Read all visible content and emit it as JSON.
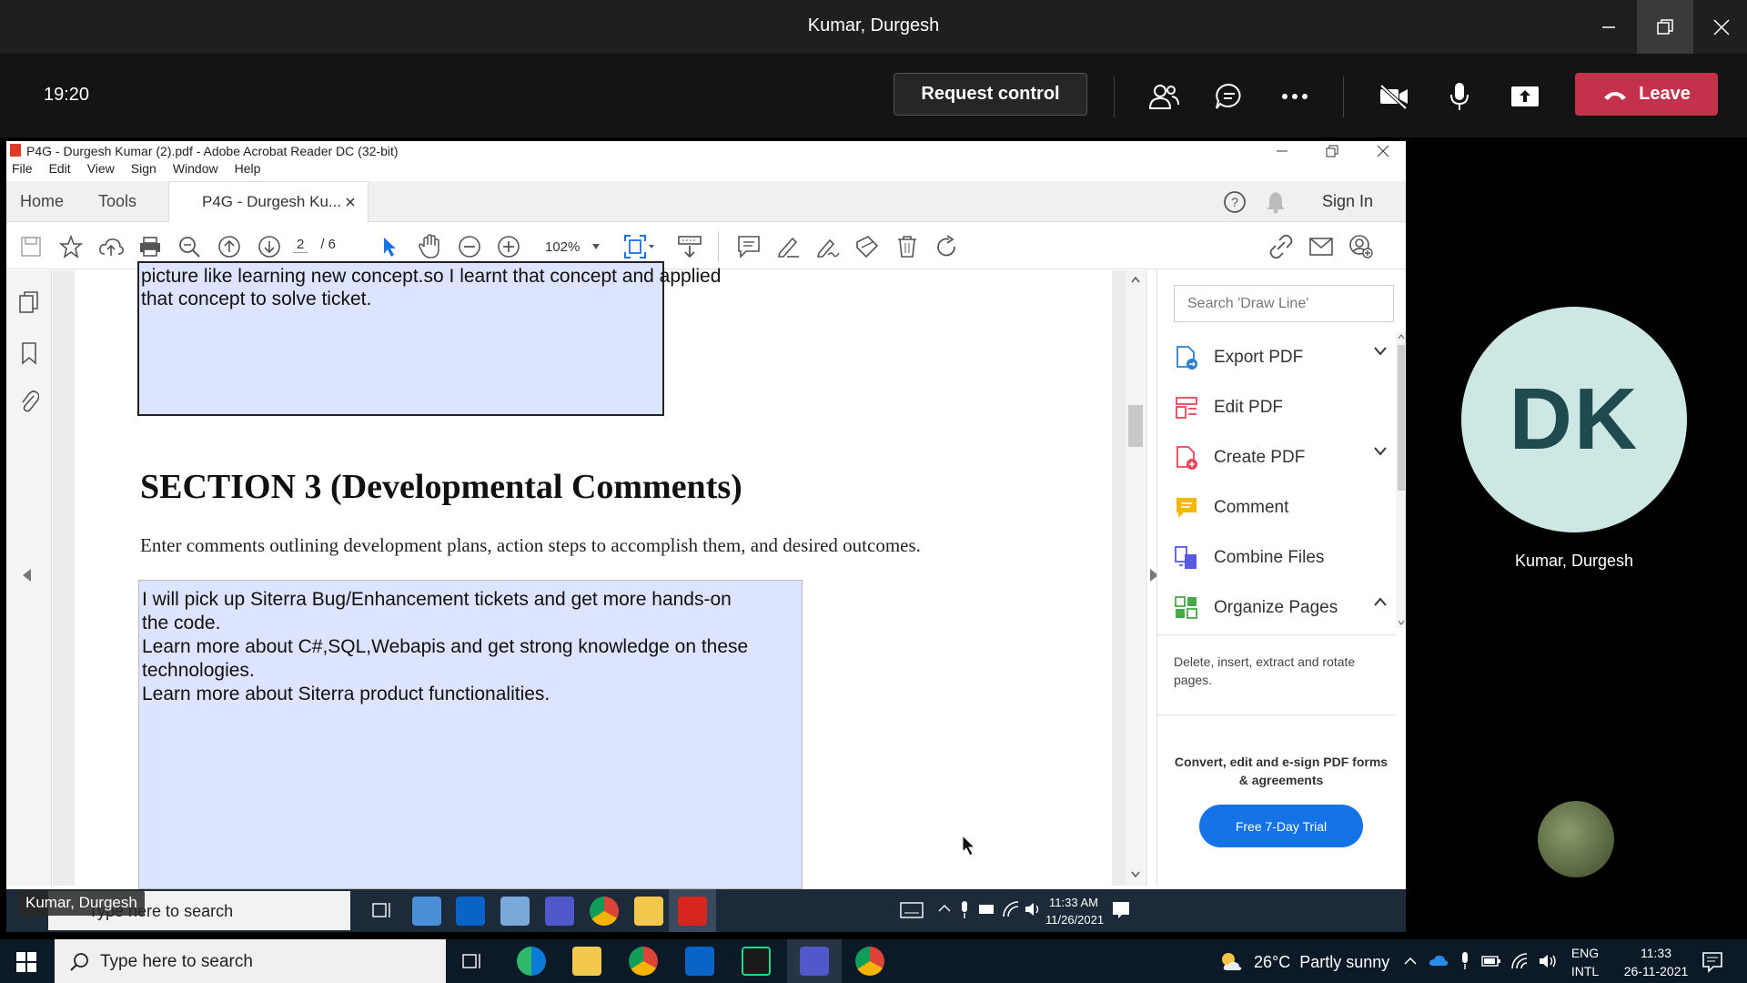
{
  "teams": {
    "title": "Kumar, Durgesh",
    "clock": "19:20",
    "request_control": "Request control",
    "leave": "Leave"
  },
  "acrobat": {
    "window_title": "P4G - Durgesh Kumar (2).pdf - Adobe Acrobat Reader DC (32-bit)",
    "menu": [
      "File",
      "Edit",
      "View",
      "Sign",
      "Window",
      "Help"
    ],
    "tabs": {
      "home": "Home",
      "tools": "Tools",
      "doc": "P4G - Durgesh Ku..."
    },
    "sign_in": "Sign In",
    "page_current": "2",
    "page_total": "/ 6",
    "zoom": "102%"
  },
  "document": {
    "top_text_line1": "picture like learning new concept.so I learnt that concept and applied",
    "top_text_line2": "that concept to solve ticket.",
    "section_heading": "SECTION 3 (Developmental Comments)",
    "instructions": "Enter comments outlining development plans, action steps to accomplish them, and desired outcomes.",
    "comment_lines": [
      "I will pick up Siterra Bug/Enhancement tickets and get more hands-on",
      "the code.",
      "Learn more about C#,SQL,Webapis and get strong knowledge on these",
      "technologies.",
      "Learn more about Siterra product functionalities."
    ]
  },
  "tools_panel": {
    "search_placeholder": "Search 'Draw Line'",
    "items": [
      {
        "label": "Export PDF",
        "icon": "export-pdf-icon",
        "color": "#2d7fd0"
      },
      {
        "label": "Edit PDF",
        "icon": "edit-pdf-icon",
        "color": "#e8435a"
      },
      {
        "label": "Create PDF",
        "icon": "create-pdf-icon",
        "color": "#e8435a"
      },
      {
        "label": "Comment",
        "icon": "comment-icon",
        "color": "#f5b800"
      },
      {
        "label": "Combine Files",
        "icon": "combine-files-icon",
        "color": "#5a5ae0"
      },
      {
        "label": "Organize Pages",
        "icon": "organize-pages-icon",
        "color": "#4aa84a"
      }
    ],
    "organize_desc": "Delete, insert, extract and rotate pages.",
    "promo": "Convert, edit and e-sign PDF forms & agreements",
    "trial_button": "Free 7-Day Trial"
  },
  "inner_taskbar": {
    "search": "Type here to search",
    "time": "11:33 AM",
    "date": "11/26/2021"
  },
  "participants": {
    "main_initials": "DK",
    "main_name": "Kumar, Durgesh",
    "presenter_tag": "Kumar, Durgesh"
  },
  "taskbar": {
    "search": "Type here to search",
    "weather": "26°C  Partly sunny",
    "lang1": "ENG",
    "lang2": "INTL",
    "time": "11:33",
    "date": "26-11-2021"
  },
  "colors": {
    "leave": "#c4314b",
    "field": "#dce4ff",
    "trial": "#1473e6"
  }
}
